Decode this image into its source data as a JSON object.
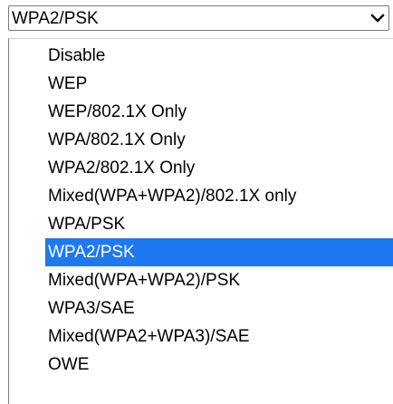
{
  "select": {
    "value": "WPA2/PSK",
    "icon": "chevron-down-icon"
  },
  "options": [
    {
      "label": "Disable"
    },
    {
      "label": "WEP"
    },
    {
      "label": "WEP/802.1X Only"
    },
    {
      "label": "WPA/802.1X Only"
    },
    {
      "label": "WPA2/802.1X Only"
    },
    {
      "label": "Mixed(WPA+WPA2)/802.1X only"
    },
    {
      "label": "WPA/PSK"
    },
    {
      "label": "WPA2/PSK",
      "selected": true
    },
    {
      "label": "Mixed(WPA+WPA2)/PSK"
    },
    {
      "label": "WPA3/SAE"
    },
    {
      "label": "Mixed(WPA2+WPA3)/SAE"
    },
    {
      "label": "OWE"
    }
  ],
  "colors": {
    "highlight": "#1e78f0",
    "border": "#7a7a7a"
  }
}
